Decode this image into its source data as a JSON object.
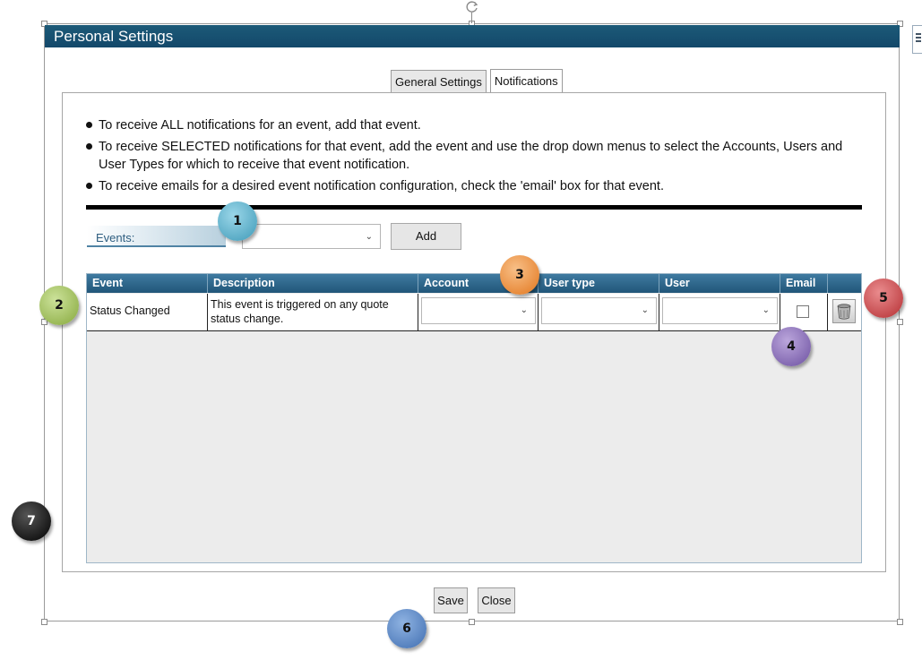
{
  "dialog": {
    "title": "Personal Settings"
  },
  "tabs": [
    {
      "label": "General Settings",
      "active": false
    },
    {
      "label": "Notifications",
      "active": true
    }
  ],
  "instructions": [
    "To receive ALL notifications for an event, add that event.",
    "To receive SELECTED notifications for that event, add the event and use the drop down menus to select the Accounts, Users and User Types for which to receive that event notification.",
    "To receive emails for a desired event notification configuration, check the 'email' box for that event."
  ],
  "events": {
    "label": "Events:",
    "selected": "",
    "add_label": "Add"
  },
  "grid": {
    "headers": [
      "Event",
      "Description",
      "Account",
      "User type",
      "User",
      "Email",
      ""
    ],
    "rows": [
      {
        "event": "Status Changed",
        "description": "This event is triggered on any quote status change.",
        "account": "",
        "user_type": "",
        "user": "",
        "email": false
      }
    ]
  },
  "footer": {
    "save_label": "Save",
    "close_label": "Close"
  },
  "callouts": [
    "1",
    "2",
    "3",
    "4",
    "5",
    "6",
    "7"
  ],
  "colors": {
    "title_bar": "#13486a",
    "grid_header": "#215679",
    "callout_1": "#5fb6d0",
    "callout_2": "#a4c35b",
    "callout_3": "#f0903a",
    "callout_4": "#8a6fb6",
    "callout_5": "#c9474a",
    "callout_6": "#4e7fc0",
    "callout_7": "#111111"
  },
  "icons": [
    "rotate-icon",
    "chevron-down-icon",
    "trash-can-icon",
    "panel-toggle-icon"
  ]
}
